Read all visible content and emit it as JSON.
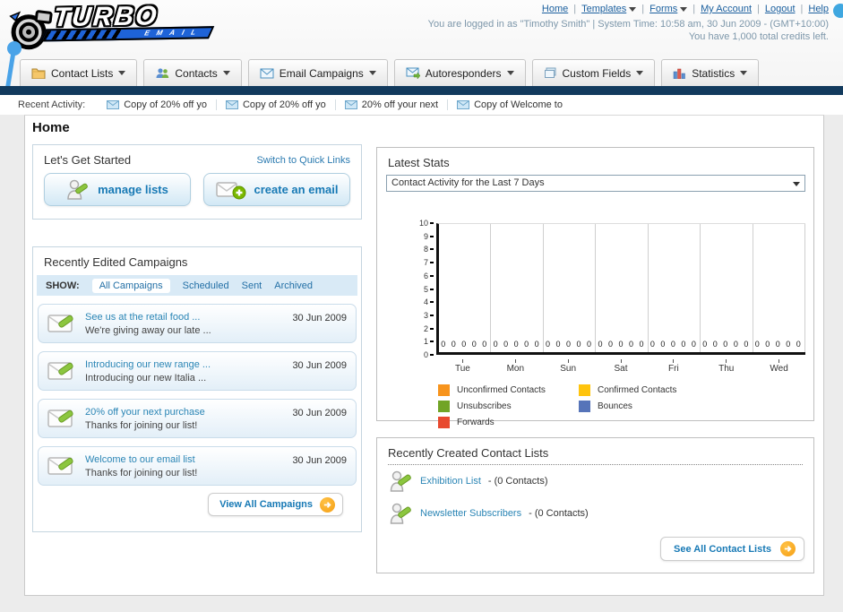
{
  "colors": {
    "navy_bar": "#123a5d",
    "link_blue": "#1a74ad",
    "button_text": "#1779b5",
    "arrow_orange": "#f5a11c"
  },
  "header": {
    "logo": {
      "title": "TURBO",
      "subtitle": "EMAIL"
    },
    "links": {
      "0": "Home",
      "1": "Templates",
      "2": "Forms",
      "3": "My Account",
      "4": "Logout",
      "5": "Help"
    },
    "login_line": "You are logged in as \"Timothy Smith\" | System Time: 10:58 am, 30 Jun 2009 - (GMT+10:00)",
    "credits_line": "You have 1,000 total credits left."
  },
  "nav": {
    "tabs": [
      {
        "label": "Contact Lists",
        "icon": "folder-icon"
      },
      {
        "label": "Contacts",
        "icon": "contacts-icon"
      },
      {
        "label": "Email Campaigns",
        "icon": "email-campaigns-icon"
      },
      {
        "label": "Autoresponders",
        "icon": "autoresponders-icon"
      },
      {
        "label": "Custom Fields",
        "icon": "custom-fields-icon"
      },
      {
        "label": "Statistics",
        "icon": "statistics-icon"
      }
    ]
  },
  "activity": {
    "label": "Recent Activity:",
    "items": {
      "0": "Copy of 20% off yo",
      "1": "Copy of 20% off yo",
      "2": "20% off your next",
      "3": "Copy of Welcome to"
    }
  },
  "page": {
    "title": "Home"
  },
  "get_started": {
    "title": "Let's Get Started",
    "switch_link": "Switch to Quick Links",
    "buttons": {
      "0": {
        "label": "manage lists"
      },
      "1": {
        "label": "create an email"
      }
    }
  },
  "campaigns": {
    "title": "Recently Edited Campaigns",
    "show_label": "SHOW:",
    "filters": {
      "0": "All Campaigns",
      "1": "Scheduled",
      "2": "Sent",
      "3": "Archived"
    },
    "active_filter": "All Campaigns",
    "items": [
      {
        "title": "See us at the retail food ...",
        "subtitle": "We're giving away our late ...",
        "date": "30 Jun 2009"
      },
      {
        "title": "Introducing our new range ...",
        "subtitle": "Introducing our new Italia ...",
        "date": "30 Jun 2009"
      },
      {
        "title": "20% off your next purchase",
        "subtitle": "Thanks for joining our list!",
        "date": "30 Jun 2009"
      },
      {
        "title": "Welcome to our email list",
        "subtitle": "Thanks for joining our list!",
        "date": "30 Jun 2009"
      }
    ],
    "view_all": "View All Campaigns"
  },
  "stats": {
    "title": "Latest Stats",
    "dropdown": "Contact Activity for the Last 7 Days"
  },
  "chart_data": {
    "type": "bar",
    "title": "Contact Activity for the Last 7 Days",
    "categories": [
      "Tue",
      "Mon",
      "Sun",
      "Sat",
      "Fri",
      "Thu",
      "Wed"
    ],
    "series": [
      {
        "name": "Unconfirmed Contacts",
        "color": "#F7941D",
        "values": [
          0,
          0,
          0,
          0,
          0,
          0,
          0
        ]
      },
      {
        "name": "Confirmed Contacts",
        "color": "#FFC40D",
        "values": [
          0,
          0,
          0,
          0,
          0,
          0,
          0
        ]
      },
      {
        "name": "Unsubscribes",
        "color": "#71A426",
        "values": [
          0,
          0,
          0,
          0,
          0,
          0,
          0
        ]
      },
      {
        "name": "Bounces",
        "color": "#5674B9",
        "values": [
          0,
          0,
          0,
          0,
          0,
          0,
          0
        ]
      },
      {
        "name": "Forwards",
        "color": "#E8492F",
        "values": [
          0,
          0,
          0,
          0,
          0,
          0,
          0
        ]
      }
    ],
    "ylim": [
      0,
      10
    ],
    "grid": true,
    "legend_position": "bottom"
  },
  "contact_lists": {
    "title": "Recently Created Contact Lists",
    "items": [
      {
        "name": "Exhibition List",
        "count": "- (0 Contacts)"
      },
      {
        "name": "Newsletter Subscribers",
        "count": "- (0 Contacts)"
      }
    ],
    "see_all": "See All Contact Lists"
  }
}
